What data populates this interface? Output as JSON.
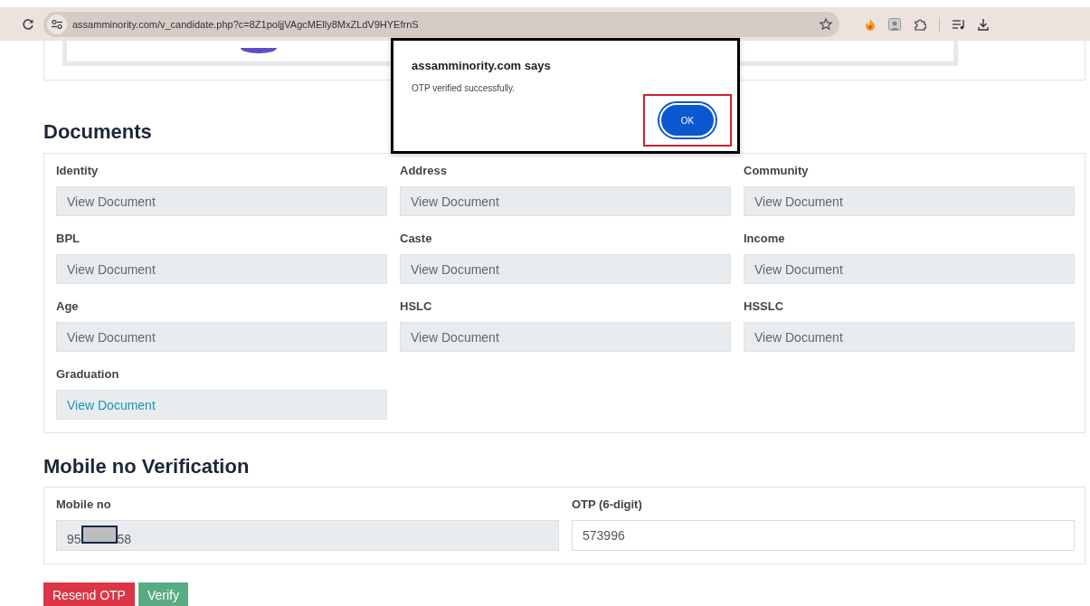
{
  "browser": {
    "url": "assamminority.com/v_candidate.php?c=8Z1poljjVAgcMElly8MxZLdV9HYEfrnS"
  },
  "documents": {
    "heading": "Documents",
    "items": [
      {
        "label": "Identity",
        "button": "View Document",
        "active": false
      },
      {
        "label": "Address",
        "button": "View Document",
        "active": false
      },
      {
        "label": "Community",
        "button": "View Document",
        "active": false
      },
      {
        "label": "BPL",
        "button": "View Document",
        "active": false
      },
      {
        "label": "Caste",
        "button": "View Document",
        "active": false
      },
      {
        "label": "Income",
        "button": "View Document",
        "active": false
      },
      {
        "label": "Age",
        "button": "View Document",
        "active": false
      },
      {
        "label": "HSLC",
        "button": "View Document",
        "active": false
      },
      {
        "label": "HSSLC",
        "button": "View Document",
        "active": false
      },
      {
        "label": "Graduation",
        "button": "View Document",
        "active": true
      }
    ]
  },
  "verification": {
    "heading": "Mobile no Verification",
    "mobile": {
      "label": "Mobile no",
      "value_start": "95",
      "value_end": "58",
      "redacted": true,
      "disabled": true
    },
    "otp": {
      "label": "OTP (6-digit)",
      "value": "573996",
      "disabled": false
    },
    "buttons": [
      {
        "label": "Resend OTP",
        "kind": "danger"
      },
      {
        "label": "Verify",
        "kind": "success"
      }
    ]
  },
  "dialog": {
    "title": "assamminority.com says",
    "message": "OTP verified successfully.",
    "button": "OK",
    "outlined": true
  }
}
